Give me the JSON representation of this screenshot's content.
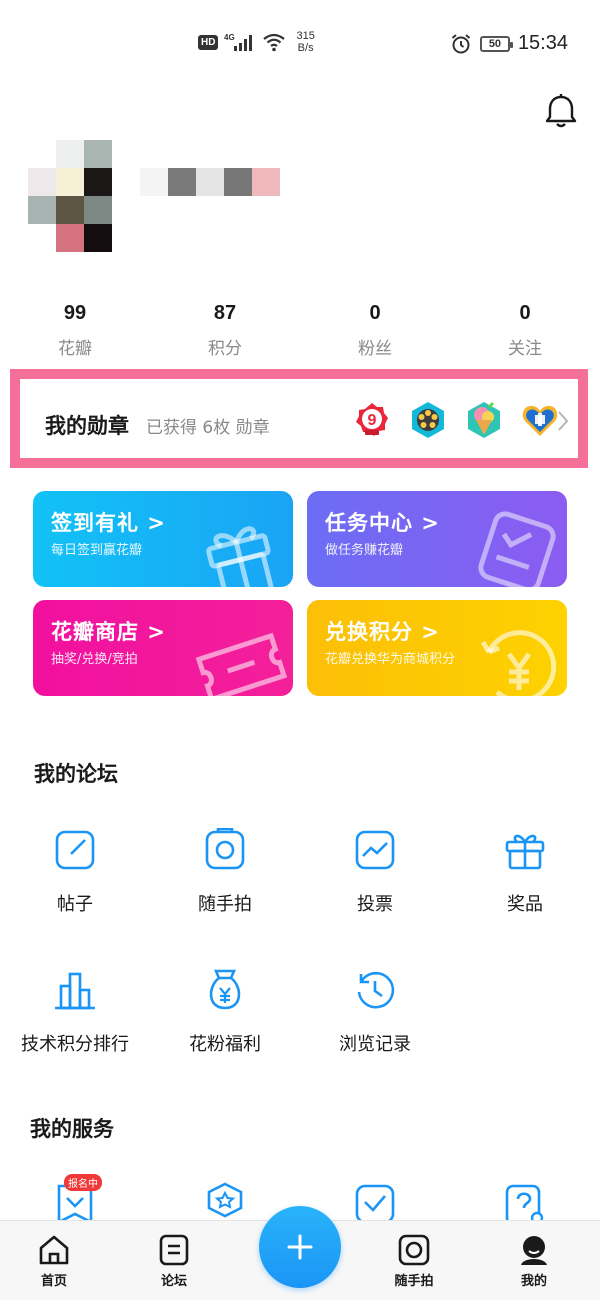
{
  "status_bar": {
    "hd": "HD",
    "network": "4G",
    "speed_value": "315",
    "speed_unit": "B/s",
    "battery": "50",
    "time": "15:34"
  },
  "stats": [
    {
      "value": "99",
      "label": "花瓣"
    },
    {
      "value": "87",
      "label": "积分"
    },
    {
      "value": "0",
      "label": "粉丝"
    },
    {
      "value": "0",
      "label": "关注"
    }
  ],
  "medals": {
    "title": "我的勋章",
    "subtitle": "已获得 6枚 勋章",
    "icons": [
      "medal-9-icon",
      "medal-film-icon",
      "medal-icecream-icon",
      "medal-heart-icon"
    ]
  },
  "cards": {
    "signin": {
      "title": "签到有礼 >",
      "subtitle": "每日签到赢花瓣",
      "icon": "gift-icon"
    },
    "task": {
      "title": "任务中心 >",
      "subtitle": "做任务赚花瓣",
      "icon": "task-icon"
    },
    "shop": {
      "title": "花瓣商店 >",
      "subtitle": "抽奖/兑换/竞拍",
      "icon": "ticket-icon"
    },
    "exchange": {
      "title": "兑换积分 >",
      "subtitle": "花瓣兑换华为商城积分",
      "icon": "yen-icon"
    }
  },
  "forum": {
    "title": "我的论坛",
    "items": [
      {
        "label": "帖子",
        "icon": "post-icon"
      },
      {
        "label": "随手拍",
        "icon": "camera-icon"
      },
      {
        "label": "投票",
        "icon": "vote-icon"
      },
      {
        "label": "奖品",
        "icon": "gift-icon"
      },
      {
        "label": "技术积分排行",
        "icon": "ranking-icon"
      },
      {
        "label": "花粉福利",
        "icon": "money-bag-icon"
      },
      {
        "label": "浏览记录",
        "icon": "history-icon"
      }
    ]
  },
  "services": {
    "title": "我的服务",
    "badge": "报名中"
  },
  "bottom_nav": {
    "home": "首页",
    "forum": "论坛",
    "camera": "随手拍",
    "mine": "我的"
  },
  "colors": {
    "accent_blue": "#1b95f5",
    "highlight_pink": "#f47098"
  }
}
